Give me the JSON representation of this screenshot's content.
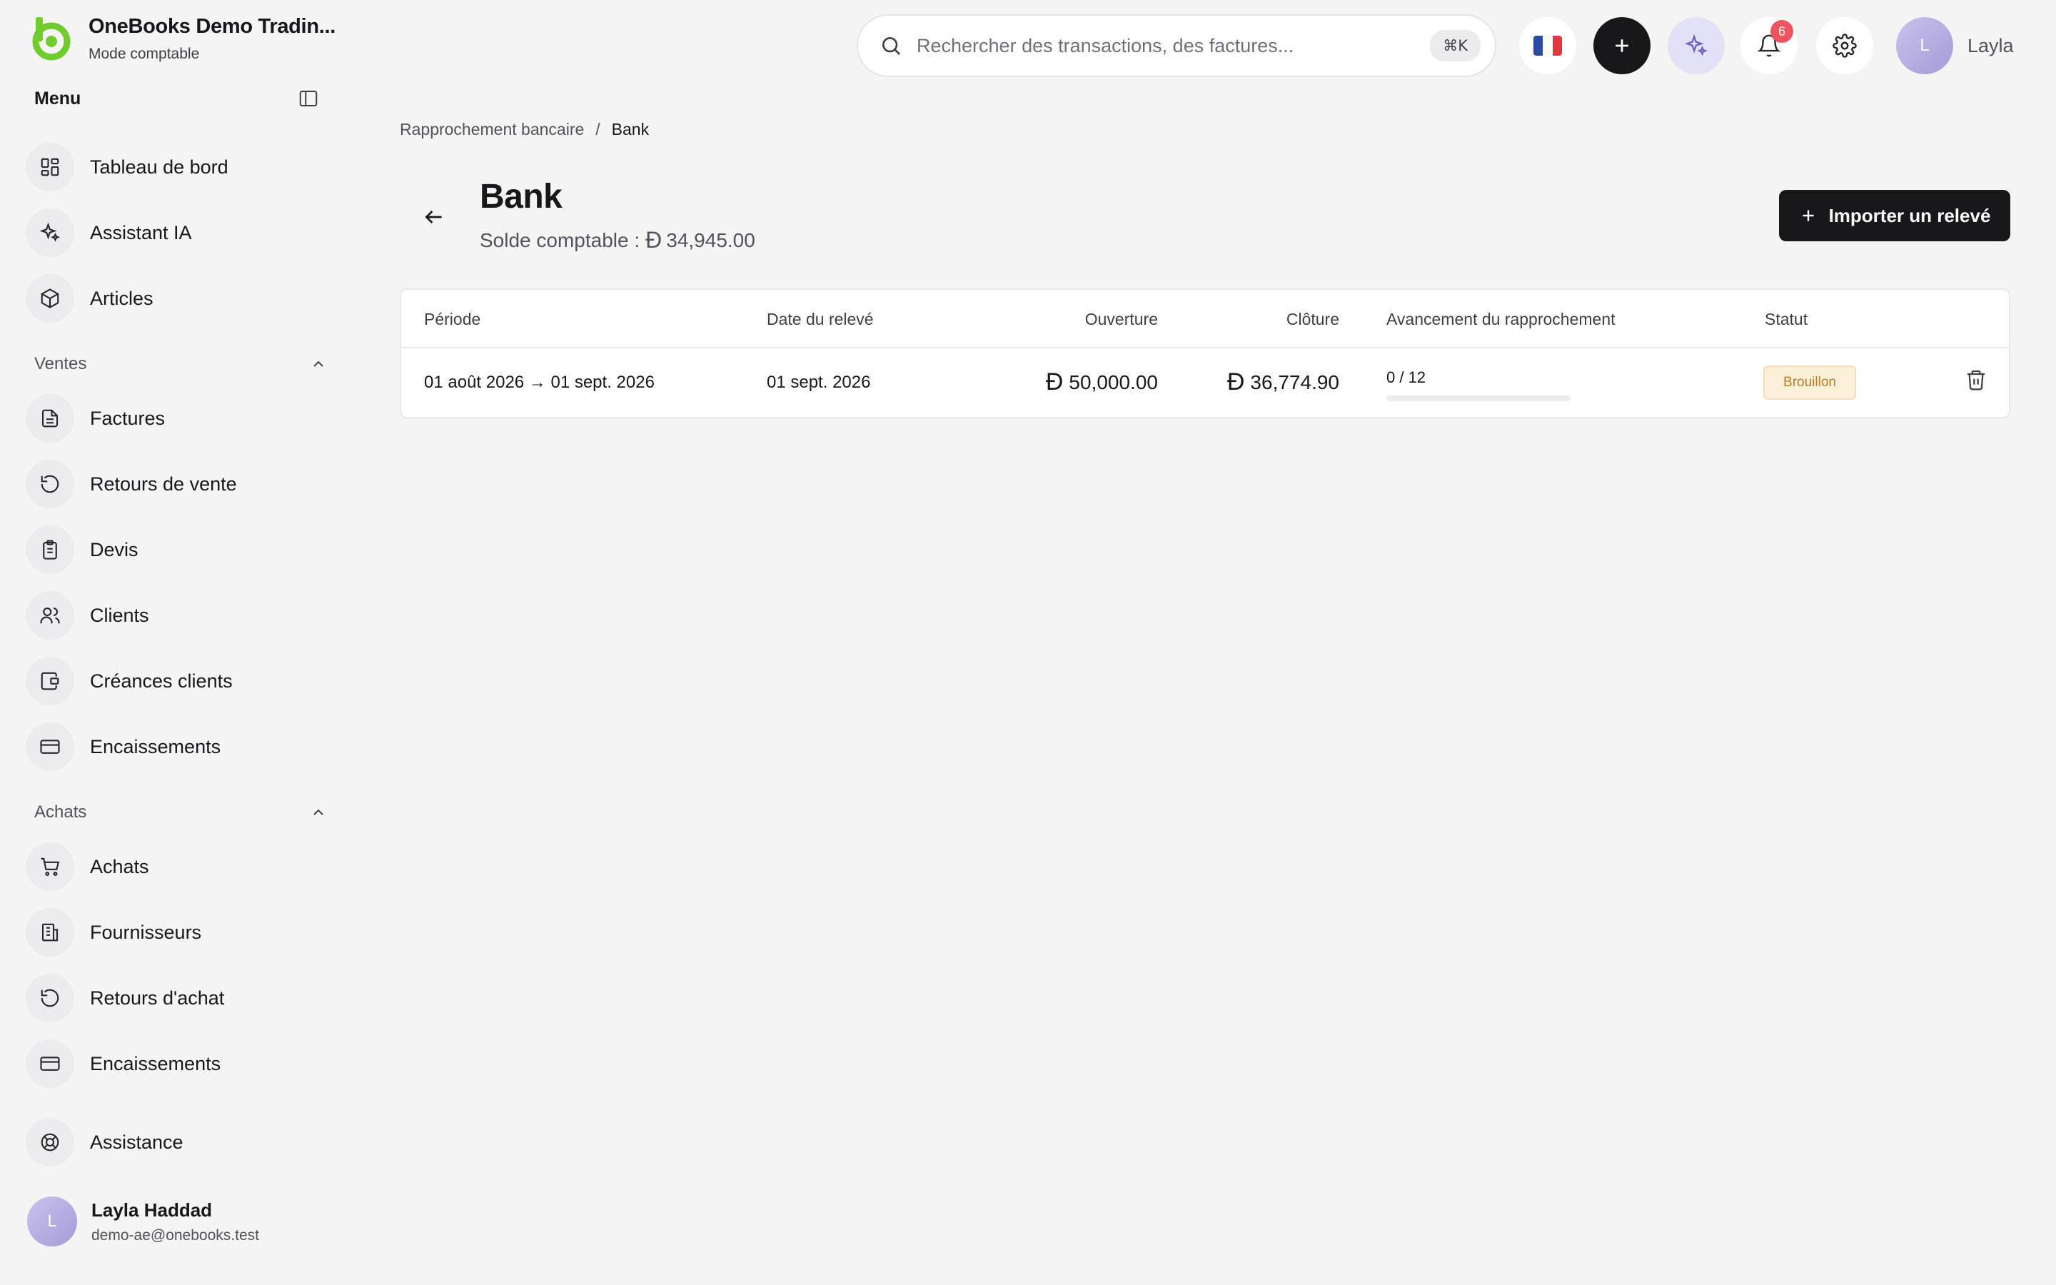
{
  "brand": {
    "name": "OneBooks Demo Tradin...",
    "mode": "Mode comptable",
    "accent": "#6fcc2b"
  },
  "menu": {
    "title": "Menu",
    "toggle_icon": "sidebar-panel-icon"
  },
  "nav_top": [
    {
      "label": "Tableau de bord",
      "icon": "dashboard-icon"
    },
    {
      "label": "Assistant IA",
      "icon": "sparkles-icon"
    },
    {
      "label": "Articles",
      "icon": "box-icon"
    }
  ],
  "sales": {
    "label": "Ventes",
    "items": [
      {
        "label": "Factures",
        "icon": "invoice-icon"
      },
      {
        "label": "Retours de vente",
        "icon": "undo-icon"
      },
      {
        "label": "Devis",
        "icon": "clipboard-icon"
      },
      {
        "label": "Clients",
        "icon": "users-icon"
      },
      {
        "label": "Créances clients",
        "icon": "wallet-icon"
      },
      {
        "label": "Encaissements",
        "icon": "credit-card-icon"
      }
    ]
  },
  "purchases": {
    "label": "Achats",
    "items": [
      {
        "label": "Achats",
        "icon": "cart-icon"
      },
      {
        "label": "Fournisseurs",
        "icon": "building-icon"
      },
      {
        "label": "Retours d'achat",
        "icon": "undo-icon"
      },
      {
        "label": "Encaissements",
        "icon": "credit-card-icon"
      }
    ]
  },
  "support": {
    "label": "Assistance",
    "icon": "lifebuoy-icon"
  },
  "user": {
    "initial": "L",
    "name": "Layla Haddad",
    "email": "demo-ae@onebooks.test",
    "short_name": "Layla"
  },
  "search": {
    "placeholder": "Rechercher des transactions, des factures...",
    "shortcut": "⌘K"
  },
  "notifications": {
    "count": "6"
  },
  "breadcrumb": {
    "parent": "Rapprochement bancaire",
    "separator": "/",
    "current": "Bank"
  },
  "page": {
    "title": "Bank",
    "balance_label": "Solde comptable :",
    "balance_value": "34,945.00",
    "currency_symbol": "Đ",
    "import_button": "Importer un relevé"
  },
  "table": {
    "headers": {
      "period": "Période",
      "statement_date": "Date du relevé",
      "opening": "Ouverture",
      "closing": "Clôture",
      "progress": "Avancement du rapprochement",
      "status": "Statut"
    },
    "rows": [
      {
        "period": "01 août 2026 → 01 sept. 2026",
        "statement_date": "01 sept. 2026",
        "opening": "50,000.00",
        "closing": "36,774.90",
        "progress_text": "0 / 12",
        "progress_fraction": 0,
        "status": "Brouillon"
      }
    ]
  }
}
